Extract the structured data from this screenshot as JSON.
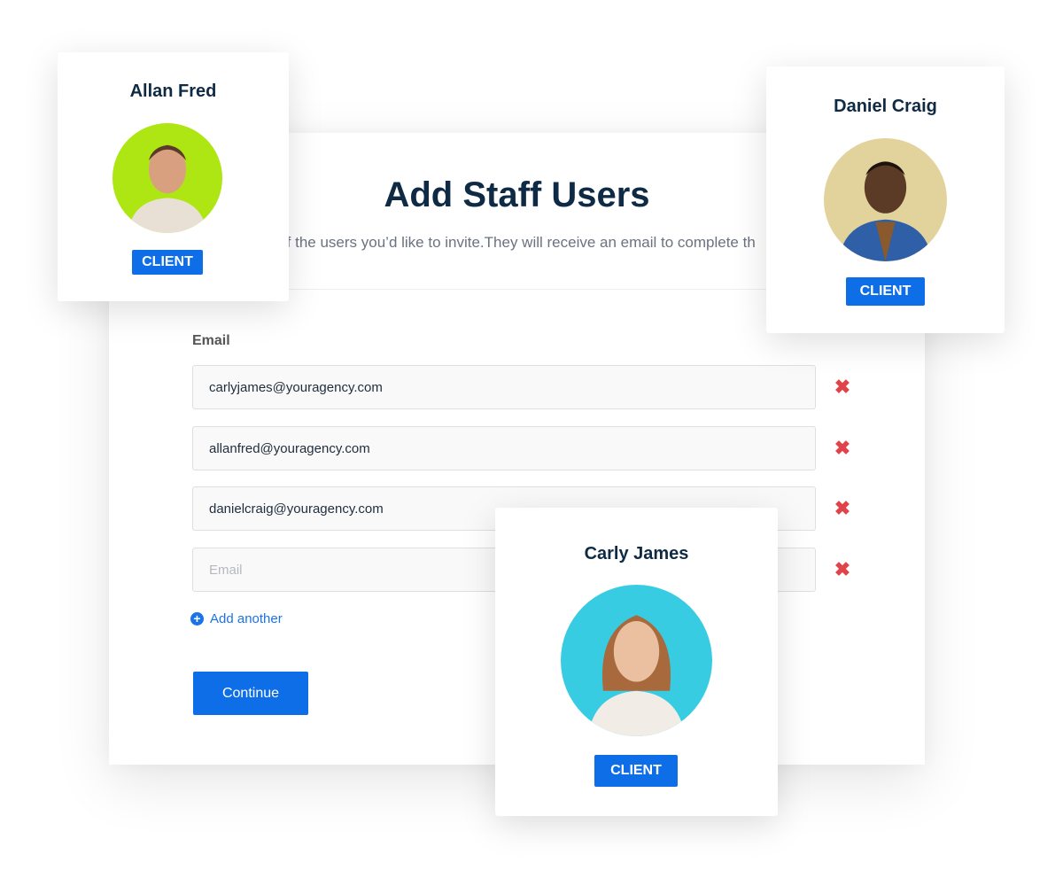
{
  "form": {
    "title": "Add Staff Users",
    "subtitle": "of the users you’d like to invite.They will receive an email to complete th",
    "email_label": "Email",
    "emails": [
      {
        "value": "carlyjames@youragency.com",
        "placeholder": "Email"
      },
      {
        "value": "allanfred@youragency.com",
        "placeholder": "Email"
      },
      {
        "value": "danielcraig@youragency.com",
        "placeholder": "Email"
      },
      {
        "value": "",
        "placeholder": "Email"
      }
    ],
    "remove_icon": "✖",
    "add_another_label": "Add another",
    "add_icon": "+",
    "continue_label": "Continue"
  },
  "cards": [
    {
      "name": "Allan Fred",
      "badge": "CLIENT",
      "avatar_bg": "#ade613",
      "avatar_icon": "person-photo"
    },
    {
      "name": "Daniel Craig",
      "badge": "CLIENT",
      "avatar_bg": "#e2d39d",
      "avatar_icon": "person-photo"
    },
    {
      "name": "Carly James",
      "badge": "CLIENT",
      "avatar_bg": "#38cce3",
      "avatar_icon": "person-photo"
    }
  ],
  "colors": {
    "accent": "#0d6ee8",
    "remove": "#e0434a",
    "heading": "#0f2a44"
  }
}
